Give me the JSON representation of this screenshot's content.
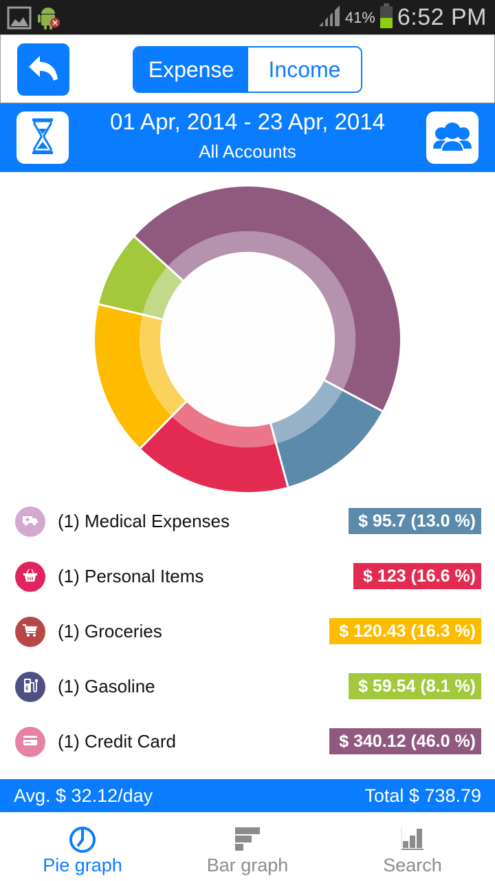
{
  "status_bar": {
    "battery_percent_label": "41%",
    "battery_level": 0.41,
    "time": "6:52 PM",
    "left_icons": [
      "gallery-notification-icon",
      "android-debug-icon"
    ],
    "right_icons": [
      "signal-icon",
      "battery-icon"
    ]
  },
  "top_bar": {
    "back_icon": "back-arrow-icon",
    "segments": [
      {
        "label": "Expense",
        "active": true
      },
      {
        "label": "Income",
        "active": false
      }
    ]
  },
  "date_bar": {
    "range": "01 Apr, 2014 - 23 Apr, 2014",
    "accounts": "All Accounts",
    "left_icon": "hourglass-icon",
    "right_icon": "accounts-group-icon"
  },
  "colors": {
    "accent": "#0a7cff",
    "medical": "#5c8aab",
    "personal": "#e32b52",
    "groceries": "#fdbc00",
    "gasoline": "#a3c83b",
    "credit_card": "#905a80"
  },
  "chart_data": {
    "type": "pie",
    "variant": "donut",
    "title": "",
    "total": 738.79,
    "start_angle_deg": 115,
    "direction": "clockwise-from-medical",
    "slices": [
      {
        "label": "Medical Expenses",
        "value": 95.7,
        "percent": 13.0,
        "color": "#5c8aab",
        "inner_color": "#96b2c8"
      },
      {
        "label": "Personal Items",
        "value": 123,
        "percent": 16.6,
        "color": "#e32b52",
        "inner_color": "#eb7589"
      },
      {
        "label": "Groceries",
        "value": 120.43,
        "percent": 16.3,
        "color": "#fdbc00",
        "inner_color": "#fbd35c"
      },
      {
        "label": "Gasoline",
        "value": 59.54,
        "percent": 8.1,
        "color": "#a3c83b",
        "inner_color": "#c2d98a"
      },
      {
        "label": "Credit Card",
        "value": 340.12,
        "percent": 46.0,
        "color": "#905a80",
        "inner_color": "#b592ad"
      }
    ]
  },
  "categories": [
    {
      "label": "(1) Medical Expenses",
      "amount": "$ 95.7 (13.0 %)",
      "icon": "ambulance-icon",
      "icon_color": "#d4a9d0",
      "badge_color": "#5c8aab"
    },
    {
      "label": "(1) Personal Items",
      "amount": "$ 123 (16.6 %)",
      "icon": "basket-icon",
      "icon_color": "#e0245e",
      "badge_color": "#e32b52"
    },
    {
      "label": "(1) Groceries",
      "amount": "$ 120.43 (16.3 %)",
      "icon": "shopping-cart-icon",
      "icon_color": "#b84848",
      "badge_color": "#fdbc00"
    },
    {
      "label": "(1) Gasoline",
      "amount": "$ 59.54 (8.1 %)",
      "icon": "fuel-pump-icon",
      "icon_color": "#4e4f82",
      "badge_color": "#a3c83b"
    },
    {
      "label": "(1) Credit Card",
      "amount": "$ 340.12 (46.0 %)",
      "icon": "credit-card-icon",
      "icon_color": "#e582a6",
      "badge_color": "#905a80"
    }
  ],
  "summary": {
    "average": "Avg. $ 32.12/day",
    "total": "Total $ 738.79"
  },
  "bottom_nav": [
    {
      "label": "Pie graph",
      "icon": "pie-graph-icon",
      "active": true
    },
    {
      "label": "Bar graph",
      "icon": "bar-graph-icon",
      "active": false
    },
    {
      "label": "Search",
      "icon": "search-chart-icon",
      "active": false
    }
  ]
}
